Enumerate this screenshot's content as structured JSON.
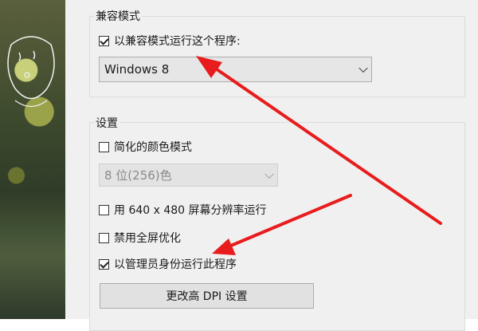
{
  "compat_section": {
    "title": "兼容模式",
    "run_compat_label": "以兼容模式运行这个程序:",
    "run_compat_checked": true,
    "os_selected": "Windows 8"
  },
  "settings_section": {
    "title": "设置",
    "reduced_color_label": "简化的颜色模式",
    "reduced_color_checked": false,
    "color_depth_selected": "8 位(256)色",
    "res_640_label": "用 640 x 480 屏幕分辨率运行",
    "res_640_checked": false,
    "disable_fullscreen_label": "禁用全屏优化",
    "disable_fullscreen_checked": false,
    "run_admin_label": "以管理员身份运行此程序",
    "run_admin_checked": true,
    "dpi_button_label": "更改高 DPI 设置"
  },
  "annotation_color": "#e81c1c"
}
